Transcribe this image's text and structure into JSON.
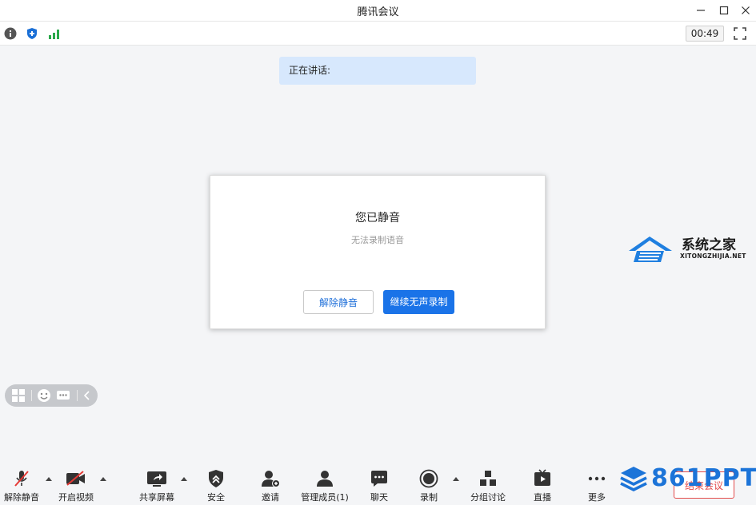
{
  "window": {
    "title": "腾讯会议"
  },
  "status": {
    "timer": "00:49"
  },
  "speaking": {
    "label": "正在讲话:"
  },
  "dialog": {
    "title": "您已静音",
    "subtitle": "无法录制语音",
    "unmute_label": "解除静音",
    "continue_label": "继续无声录制"
  },
  "toolbar": {
    "unmute": "解除静音",
    "video": "开启视频",
    "share": "共享屏幕",
    "security": "安全",
    "invite": "邀请",
    "members": "管理成员(1)",
    "chat": "聊天",
    "record": "录制",
    "breakout": "分组讨论",
    "live": "直播",
    "more": "更多",
    "end": "结束会议"
  },
  "watermarks": {
    "xitong_cn": "系统之家",
    "xitong_en": "XITONGZHIJIA.NET",
    "ppt": "861PPT"
  },
  "colors": {
    "accent": "#1a73e8",
    "speaking_bg": "#d7e8fd",
    "end_red": "#e24b4b",
    "shield_blue": "#1a6fd6",
    "signal_green": "#2aa84a"
  }
}
